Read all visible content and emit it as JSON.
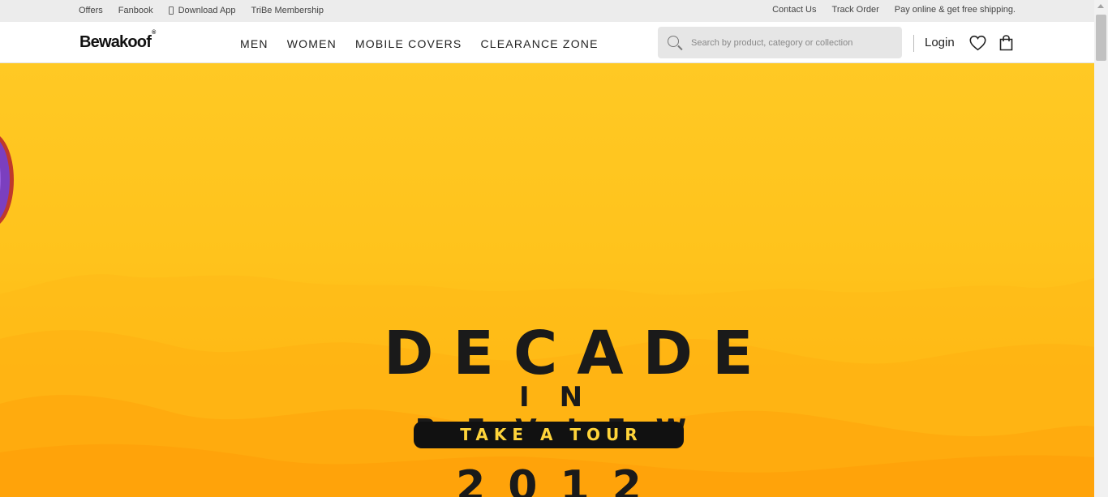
{
  "topbar": {
    "left": [
      "Offers",
      "Fanbook",
      "Download App",
      "TriBe Membership"
    ],
    "right": [
      "Contact Us",
      "Track Order",
      "Pay online & get free shipping."
    ]
  },
  "header": {
    "logo": "Bewakoof",
    "logo_mark": "®",
    "nav": [
      "MEN",
      "WOMEN",
      "MOBILE COVERS",
      "CLEARANCE ZONE"
    ],
    "search_placeholder": "Search by product, category or collection",
    "login": "Login"
  },
  "hero": {
    "title": "DECADE",
    "subtitle": "IN REVIEW",
    "cta": "TAKE A TOUR",
    "year": "2012",
    "colors": {
      "background": "#ffc31c",
      "text": "#1a1a1a",
      "cta_bg": "#111111",
      "cta_text": "#ffd43a"
    }
  },
  "icons": [
    "phone-icon",
    "search-icon",
    "heart-icon",
    "bag-icon"
  ]
}
